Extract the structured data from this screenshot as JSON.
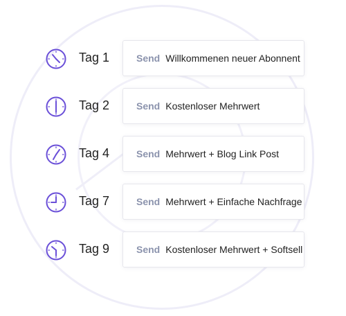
{
  "steps": [
    {
      "day": "Tag 1",
      "send": "Send",
      "subject": "Willkommenen neuer Abonnent",
      "icon": "clock-icon"
    },
    {
      "day": "Tag 2",
      "send": "Send",
      "subject": "Kostenloser Mehrwert",
      "icon": "clock-icon"
    },
    {
      "day": "Tag 4",
      "send": "Send",
      "subject": "Mehrwert + Blog Link Post",
      "icon": "clock-icon"
    },
    {
      "day": "Tag 7",
      "send": "Send",
      "subject": "Mehrwert + Einfache Nachfrage",
      "icon": "clock-icon"
    },
    {
      "day": "Tag 9",
      "send": "Send",
      "subject": "Kostenloser Mehrwert + Softsell",
      "icon": "clock-icon"
    }
  ],
  "colors": {
    "accent": "#6a4fd8",
    "send_label": "#8b93ad",
    "card_border": "#e6e6ec",
    "decor": "#eeedf8"
  }
}
